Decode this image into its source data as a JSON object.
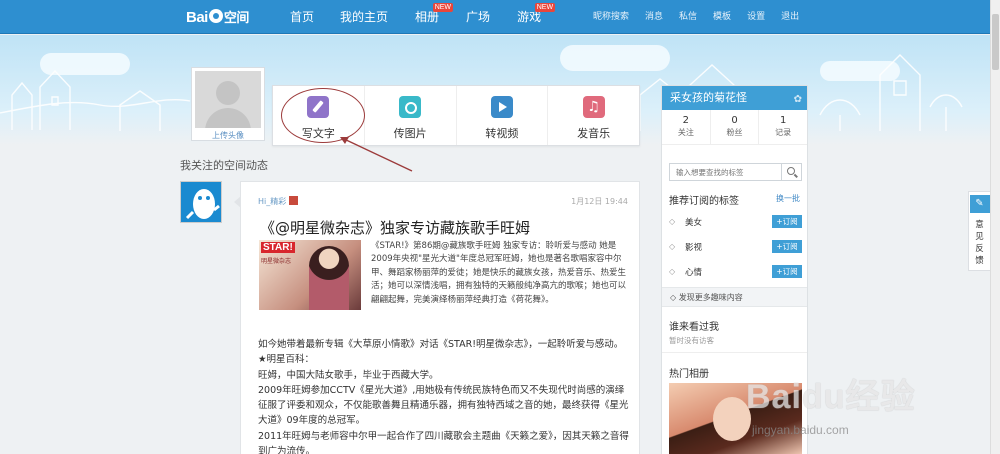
{
  "logo": {
    "text_bai": "Bai",
    "text_kongjian": "空间"
  },
  "nav": {
    "items": [
      {
        "label": "首页",
        "badge": ""
      },
      {
        "label": "我的主页",
        "badge": ""
      },
      {
        "label": "相册",
        "badge": "NEW"
      },
      {
        "label": "广场",
        "badge": ""
      },
      {
        "label": "游戏",
        "badge": "NEW"
      }
    ],
    "right": [
      "昵称搜索",
      "消息",
      "私信",
      "模板",
      "设置",
      "退出"
    ]
  },
  "avatar": {
    "upload_label": "上传头像"
  },
  "publish": {
    "items": [
      {
        "label": "写文字",
        "icon": "pen-icon"
      },
      {
        "label": "传图片",
        "icon": "camera-icon"
      },
      {
        "label": "转视频",
        "icon": "video-icon"
      },
      {
        "label": "发音乐",
        "icon": "music-icon"
      }
    ]
  },
  "feed": {
    "title": "我关注的空间动态",
    "post": {
      "author": "Hi_精彩",
      "date": "1月12日 19:44",
      "headline": "《@明星微杂志》独家专访藏族歌手旺姆",
      "thumb_star": "STAR!",
      "thumb_sub": "明星微杂志",
      "intro": "《STAR!》第86期@藏族歌手旺姆 独家专访：聆听爱与感动 她是2009年央视\"星光大道\"年度总冠军旺姆，她也是著名歌唱家容中尔甲、舞蹈家杨丽萍的爱徒；她是快乐的藏族女孩，热爱音乐、热爱生活；她可以深情浅唱，拥有独特的天籁般纯净高亢的歌喉；她也可以翩翩起舞，完美演绎杨丽萍经典打造《荷花舞》。",
      "body_lines": [
        "如今她带着最新专辑《大草原小情歌》对话《STAR!明星微杂志》，一起聆听爱与感动。",
        "★明星百科：",
        "旺姆，中国大陆女歌手，毕业于西藏大学。",
        "2009年旺姆参加CCTV《星光大道》,用她极有传统民族特色而又不失现代时尚感的演绎征服了评委和观众，不仅能歌善舞且精通乐器，拥有独特西域之音的她，最终获得《星光大道》09年度的总冠军。",
        "2011年旺姆与老师容中尔甲一起合作了四川藏歌会主题曲《天籁之爱》，因其天籁之音得到广为流传。"
      ]
    }
  },
  "sidebar": {
    "username": "采女孩的菊花怪",
    "stats": [
      {
        "num": "2",
        "label": "关注"
      },
      {
        "num": "0",
        "label": "粉丝"
      },
      {
        "num": "1",
        "label": "记录"
      }
    ],
    "search_placeholder": "输入想要查找的标签",
    "tags_title": "推荐订阅的标签",
    "tags_switch": "换一批",
    "tags": [
      {
        "name": "美女",
        "button": "+订阅"
      },
      {
        "name": "影视",
        "button": "+订阅"
      },
      {
        "name": "心情",
        "button": "+订阅"
      }
    ],
    "more_tags": "发现更多趣味内容",
    "visitors_title": "谁来看过我",
    "visitors_empty": "暂时没有访客",
    "album_title": "热门相册"
  },
  "feedback": {
    "label": "意见反馈"
  },
  "watermark": {
    "big": "Baidu经验",
    "small": "jingyan.baidu.com"
  }
}
